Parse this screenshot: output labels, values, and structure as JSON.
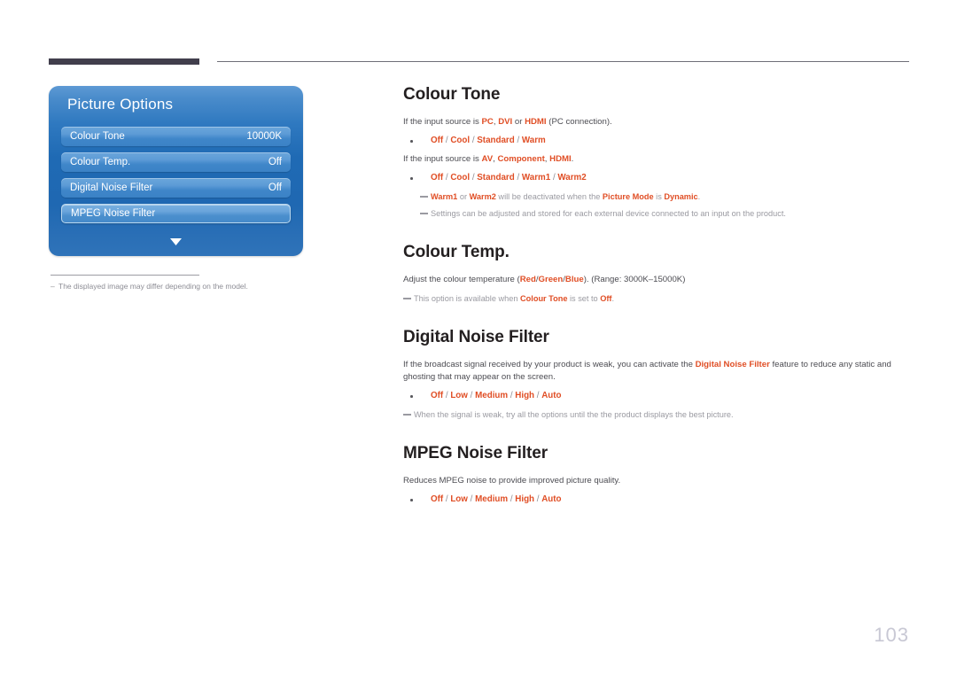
{
  "page": {
    "number": "103"
  },
  "osd": {
    "title": "Picture Options",
    "items": [
      {
        "label": "Colour Tone",
        "value": "10000K",
        "selected": false
      },
      {
        "label": "Colour Temp.",
        "value": "Off",
        "selected": false
      },
      {
        "label": "Digital Noise Filter",
        "value": "Off",
        "selected": false
      },
      {
        "label": "MPEG Noise Filter",
        "value": "",
        "selected": true
      }
    ],
    "scroll_icon": "chevron-down-icon",
    "caption": {
      "dash": "–",
      "text": "The displayed image may differ depending on the model."
    }
  },
  "sections": [
    {
      "id": "colour-tone",
      "title": "Colour Tone",
      "lines": [
        {
          "type": "body",
          "parts": [
            {
              "t": "If the input source is ",
              "s": "plain"
            },
            {
              "t": "PC",
              "s": "em"
            },
            {
              "t": ", ",
              "s": "plain"
            },
            {
              "t": "DVI",
              "s": "em"
            },
            {
              "t": " or ",
              "s": "plain"
            },
            {
              "t": "HDMI",
              "s": "em"
            },
            {
              "t": " (PC connection).",
              "s": "plain"
            }
          ]
        },
        {
          "type": "bullet",
          "parts": [
            {
              "t": "Off",
              "s": "em"
            },
            {
              "t": " / ",
              "s": "sep"
            },
            {
              "t": "Cool",
              "s": "em"
            },
            {
              "t": " / ",
              "s": "sep"
            },
            {
              "t": "Standard",
              "s": "em"
            },
            {
              "t": " / ",
              "s": "sep"
            },
            {
              "t": "Warm",
              "s": "em"
            }
          ]
        },
        {
          "type": "body",
          "parts": [
            {
              "t": "If the input source is ",
              "s": "plain"
            },
            {
              "t": "AV",
              "s": "em"
            },
            {
              "t": ", ",
              "s": "plain"
            },
            {
              "t": "Component",
              "s": "em"
            },
            {
              "t": ", ",
              "s": "plain"
            },
            {
              "t": "HDMI",
              "s": "em"
            },
            {
              "t": ".",
              "s": "plain"
            }
          ]
        },
        {
          "type": "bullet",
          "parts": [
            {
              "t": "Off",
              "s": "em"
            },
            {
              "t": " / ",
              "s": "sep"
            },
            {
              "t": "Cool",
              "s": "em"
            },
            {
              "t": " / ",
              "s": "sep"
            },
            {
              "t": "Standard",
              "s": "em"
            },
            {
              "t": " / ",
              "s": "sep"
            },
            {
              "t": "Warm1",
              "s": "em"
            },
            {
              "t": " / ",
              "s": "sep"
            },
            {
              "t": "Warm2",
              "s": "em"
            }
          ]
        },
        {
          "type": "note",
          "parts": [
            {
              "t": "Warm1",
              "s": "em"
            },
            {
              "t": " or ",
              "s": "plain"
            },
            {
              "t": "Warm2",
              "s": "em"
            },
            {
              "t": " will be deactivated when the ",
              "s": "plain"
            },
            {
              "t": "Picture Mode",
              "s": "em"
            },
            {
              "t": " is ",
              "s": "plain"
            },
            {
              "t": "Dynamic",
              "s": "em"
            },
            {
              "t": ".",
              "s": "plain"
            }
          ]
        },
        {
          "type": "note",
          "parts": [
            {
              "t": "Settings can be adjusted and stored for each external device connected to an input on the product.",
              "s": "plain"
            }
          ]
        }
      ]
    },
    {
      "id": "colour-temp",
      "title": "Colour Temp.",
      "lines": [
        {
          "type": "body",
          "parts": [
            {
              "t": "Adjust the colour temperature (",
              "s": "plain"
            },
            {
              "t": "Red",
              "s": "em"
            },
            {
              "t": "/",
              "s": "plain"
            },
            {
              "t": "Green",
              "s": "em"
            },
            {
              "t": "/",
              "s": "plain"
            },
            {
              "t": "Blue",
              "s": "em"
            },
            {
              "t": "). (Range: 3000K–15000K)",
              "s": "plain"
            }
          ]
        },
        {
          "type": "note-flush",
          "parts": [
            {
              "t": "This option is available when ",
              "s": "plain"
            },
            {
              "t": "Colour Tone",
              "s": "em"
            },
            {
              "t": " is set to ",
              "s": "plain"
            },
            {
              "t": "Off",
              "s": "em"
            },
            {
              "t": ".",
              "s": "plain"
            }
          ]
        }
      ]
    },
    {
      "id": "digital-noise-filter",
      "title": "Digital Noise Filter",
      "lines": [
        {
          "type": "body",
          "parts": [
            {
              "t": "If the broadcast signal received by your product is weak, you can activate the ",
              "s": "plain"
            },
            {
              "t": "Digital Noise Filter",
              "s": "em"
            },
            {
              "t": " feature to reduce any static and ghosting that may appear on the screen.",
              "s": "plain"
            }
          ]
        },
        {
          "type": "bullet",
          "parts": [
            {
              "t": "Off",
              "s": "em"
            },
            {
              "t": " / ",
              "s": "sep"
            },
            {
              "t": "Low",
              "s": "em"
            },
            {
              "t": " / ",
              "s": "sep"
            },
            {
              "t": "Medium",
              "s": "em"
            },
            {
              "t": " / ",
              "s": "sep"
            },
            {
              "t": "High",
              "s": "em"
            },
            {
              "t": " / ",
              "s": "sep"
            },
            {
              "t": "Auto",
              "s": "em"
            }
          ]
        },
        {
          "type": "note-flush",
          "parts": [
            {
              "t": "When the signal is weak, try all the options until the the product displays the best picture.",
              "s": "plain"
            }
          ]
        }
      ]
    },
    {
      "id": "mpeg-noise-filter",
      "title": "MPEG Noise Filter",
      "lines": [
        {
          "type": "body",
          "parts": [
            {
              "t": "Reduces MPEG noise to provide improved picture quality.",
              "s": "plain"
            }
          ]
        },
        {
          "type": "bullet",
          "parts": [
            {
              "t": "Off",
              "s": "em"
            },
            {
              "t": " / ",
              "s": "sep"
            },
            {
              "t": "Low",
              "s": "em"
            },
            {
              "t": " / ",
              "s": "sep"
            },
            {
              "t": "Medium",
              "s": "em"
            },
            {
              "t": " / ",
              "s": "sep"
            },
            {
              "t": "High",
              "s": "em"
            },
            {
              "t": " / ",
              "s": "sep"
            },
            {
              "t": "Auto",
              "s": "em"
            }
          ]
        }
      ]
    }
  ],
  "colors": {
    "accent": "#e04e25",
    "heading": "#231f20",
    "body": "#4c4c52",
    "note": "#9a9aa1",
    "rule_dark": "#413e4c",
    "osd_blue": "#1f6ab4",
    "page_number": "#c8c8d4"
  }
}
